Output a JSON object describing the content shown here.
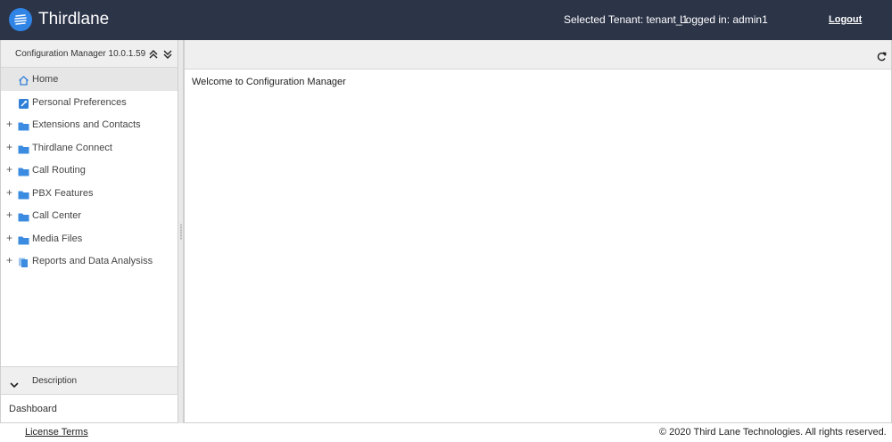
{
  "header": {
    "brand": "Thirdlane",
    "logo_icon": "thirdlane-logo-icon",
    "tenant_text": "Selected Tenant: tenant_1",
    "logged_in_text": "Logged in: admin1",
    "logout_label": "Logout",
    "colors": {
      "bar": "#2c3448",
      "logo": "#2f84e6"
    }
  },
  "sidebar": {
    "title": "Configuration Manager 10.0.1.59",
    "collapse_icon": "double-chevron-up-icon",
    "expand_icon": "double-chevron-down-icon",
    "items": [
      {
        "label": "Home",
        "icon": "home-icon",
        "expandable": false,
        "active": true
      },
      {
        "label": "Personal Preferences",
        "icon": "wrench-icon",
        "expandable": false
      },
      {
        "label": "Extensions and Contacts",
        "icon": "folder-icon",
        "expandable": true,
        "plus": "+"
      },
      {
        "label": "Thirdlane Connect",
        "icon": "folder-icon",
        "expandable": true,
        "plus": "+"
      },
      {
        "label": "Call Routing",
        "icon": "folder-icon",
        "expandable": true,
        "plus": "+"
      },
      {
        "label": "PBX Features",
        "icon": "folder-icon",
        "expandable": true,
        "plus": "+"
      },
      {
        "label": "Call Center",
        "icon": "folder-icon",
        "expandable": true,
        "plus": "+"
      },
      {
        "label": "Media Files",
        "icon": "folder-icon",
        "expandable": true,
        "plus": "+"
      },
      {
        "label": "Reports and Data Analysiss",
        "icon": "report-icon",
        "expandable": true,
        "plus": "+"
      }
    ],
    "description": {
      "title": "Description",
      "chevron_icon": "chevron-down-icon",
      "body": "Dashboard"
    }
  },
  "main": {
    "refresh_icon": "refresh-icon",
    "welcome": "Welcome to Configuration Manager"
  },
  "footer": {
    "license_link": "License Terms",
    "copyright": "© 2020 Third Lane Technologies. All rights reserved."
  }
}
